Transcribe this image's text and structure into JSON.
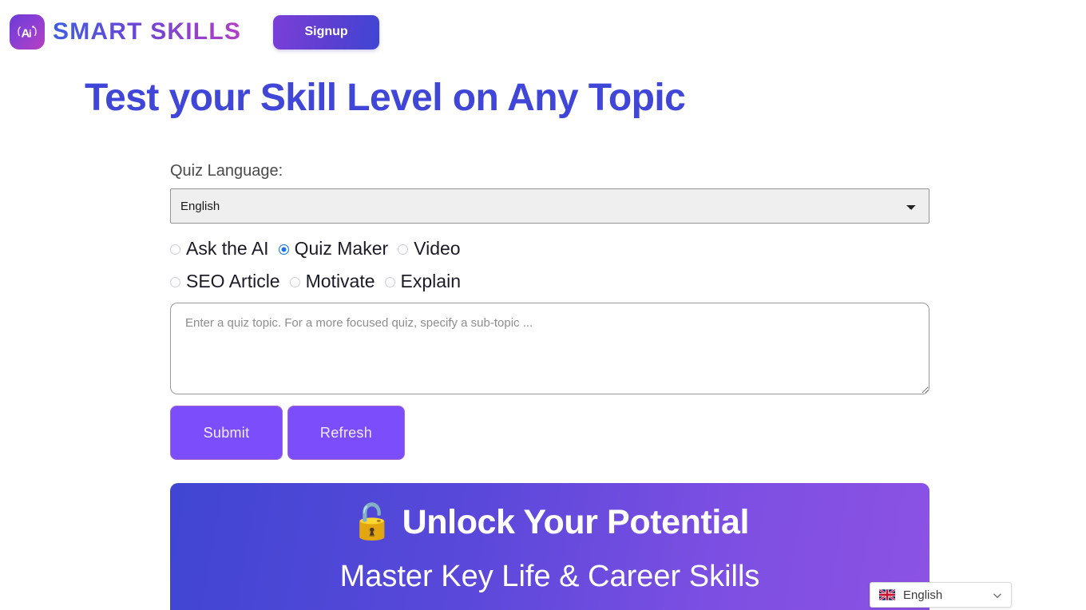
{
  "brand": {
    "name": "SMART SKILLS",
    "logo_letters": "Ai"
  },
  "header": {
    "signup_label": "Signup"
  },
  "page": {
    "title": "Test your Skill Level on Any Topic"
  },
  "form": {
    "language_label": "Quiz Language:",
    "language_value": "English",
    "language_options": [
      "English"
    ],
    "modes": [
      {
        "label": "Ask the AI",
        "checked": false
      },
      {
        "label": "Quiz Maker",
        "checked": true
      },
      {
        "label": "Video",
        "checked": false
      },
      {
        "label": "SEO Article",
        "checked": false
      },
      {
        "label": "Motivate",
        "checked": false
      },
      {
        "label": "Explain",
        "checked": false
      }
    ],
    "topic_placeholder": "Enter a quiz topic. For a more focused quiz, specify a sub-topic ...",
    "topic_value": "",
    "submit_label": "Submit",
    "refresh_label": "Refresh"
  },
  "promo": {
    "title": "🔓 Unlock Your Potential",
    "subtitle": "Master Key Life & Career Skills"
  },
  "language_widget": {
    "label": "English"
  },
  "colors": {
    "title_blue": "#3f46d8",
    "button_purple": "#7c4dfb",
    "radio_selected_blue": "#1a73e8",
    "banner_gradient_start": "#4046d2",
    "banner_gradient_end": "#8c52e4"
  }
}
